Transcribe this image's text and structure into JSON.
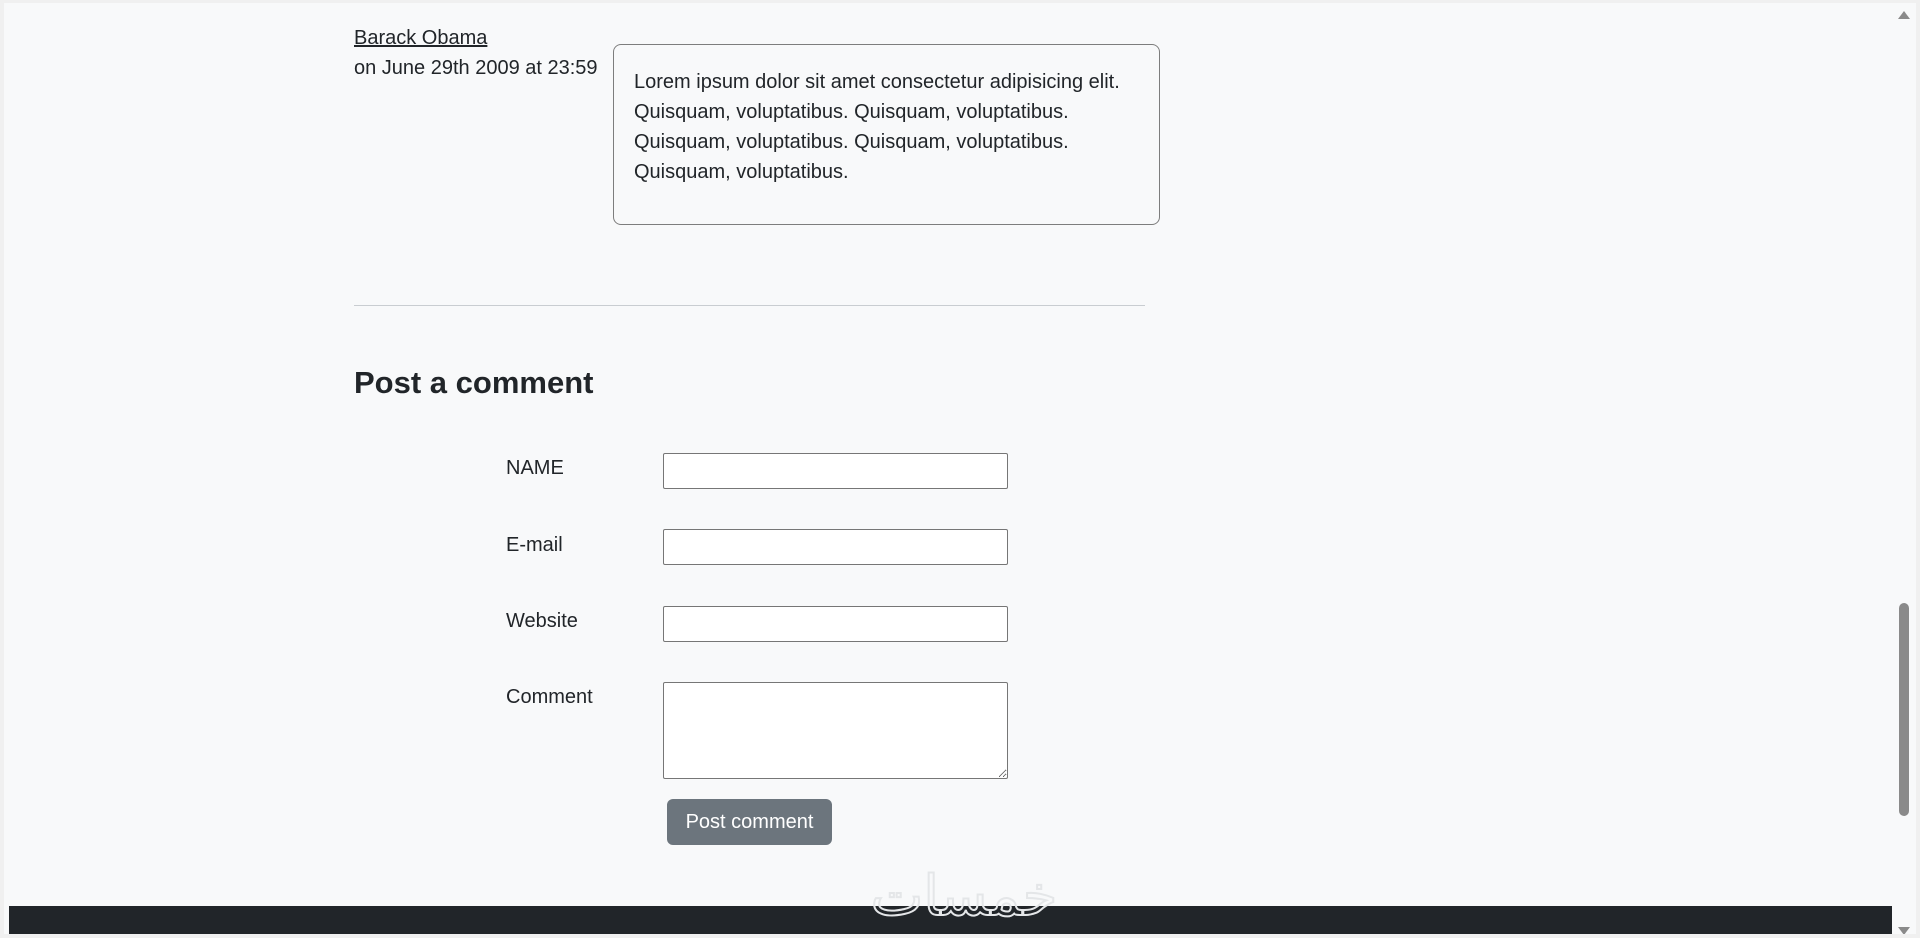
{
  "comment": {
    "author": "Barack Obama",
    "date": "on June 29th 2009 at 23:59",
    "text": "Lorem ipsum dolor sit amet consectetur adipisicing elit. Quisquam, voluptatibus. Quisquam, voluptatibus. Quisquam, voluptatibus. Quisquam, voluptatibus. Quisquam, voluptatibus."
  },
  "form": {
    "heading": "Post a comment",
    "fields": {
      "name_label": "NAME",
      "email_label": "E-mail",
      "website_label": "Website",
      "comment_label": "Comment"
    },
    "submit_label": "Post comment"
  },
  "watermark": {
    "text": "خمسات"
  },
  "colors": {
    "background": "#f8f9fa",
    "button": "#6c757d",
    "footer": "#212529"
  }
}
